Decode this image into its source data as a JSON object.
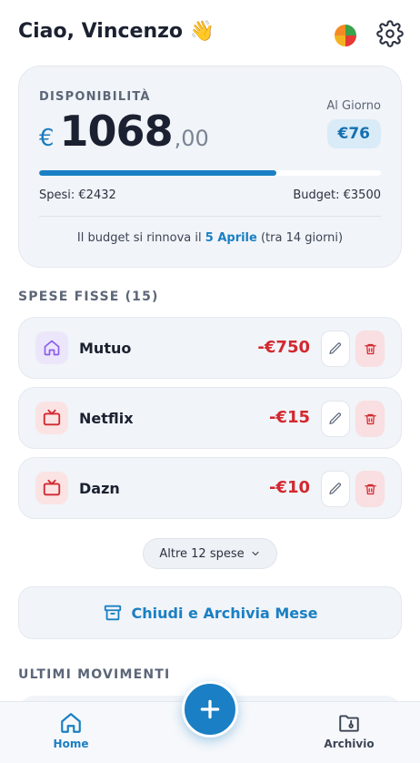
{
  "header": {
    "greeting": "Ciao, Vincenzo",
    "wave_emoji": "👋",
    "stats_icon": "pie-chart-icon",
    "settings_icon": "gear-icon"
  },
  "budget": {
    "label": "DISPONIBILITÀ",
    "currency": "€",
    "amount_int": "1068",
    "amount_dec": ",00",
    "per_day_label": "Al Giorno",
    "per_day_value": "€76",
    "progress_fraction": 0.695,
    "spent": "Spesi: €2432",
    "total": "Budget: €3500",
    "renew_prefix": "Il budget si rinnova il ",
    "renew_date": "5 Aprile",
    "renew_suffix": " (tra 14 giorni)"
  },
  "fixed": {
    "title": "SPESE FISSE (15)",
    "items": [
      {
        "name": "Mutuo",
        "amount": "-€750",
        "icon": "house-icon"
      },
      {
        "name": "Netflix",
        "amount": "-€15",
        "icon": "tv-icon"
      },
      {
        "name": "Dazn",
        "amount": "-€10",
        "icon": "tv-icon"
      }
    ],
    "more_label": "Altre 12 spese"
  },
  "archive_label": "Chiudi e Archivia Mese",
  "recent_title": "ULTIMI MOVIMENTI",
  "nav": {
    "home": "Home",
    "archive": "Archivio"
  },
  "colors": {
    "accent": "#1a7fc4",
    "expense": "#d3282f"
  }
}
